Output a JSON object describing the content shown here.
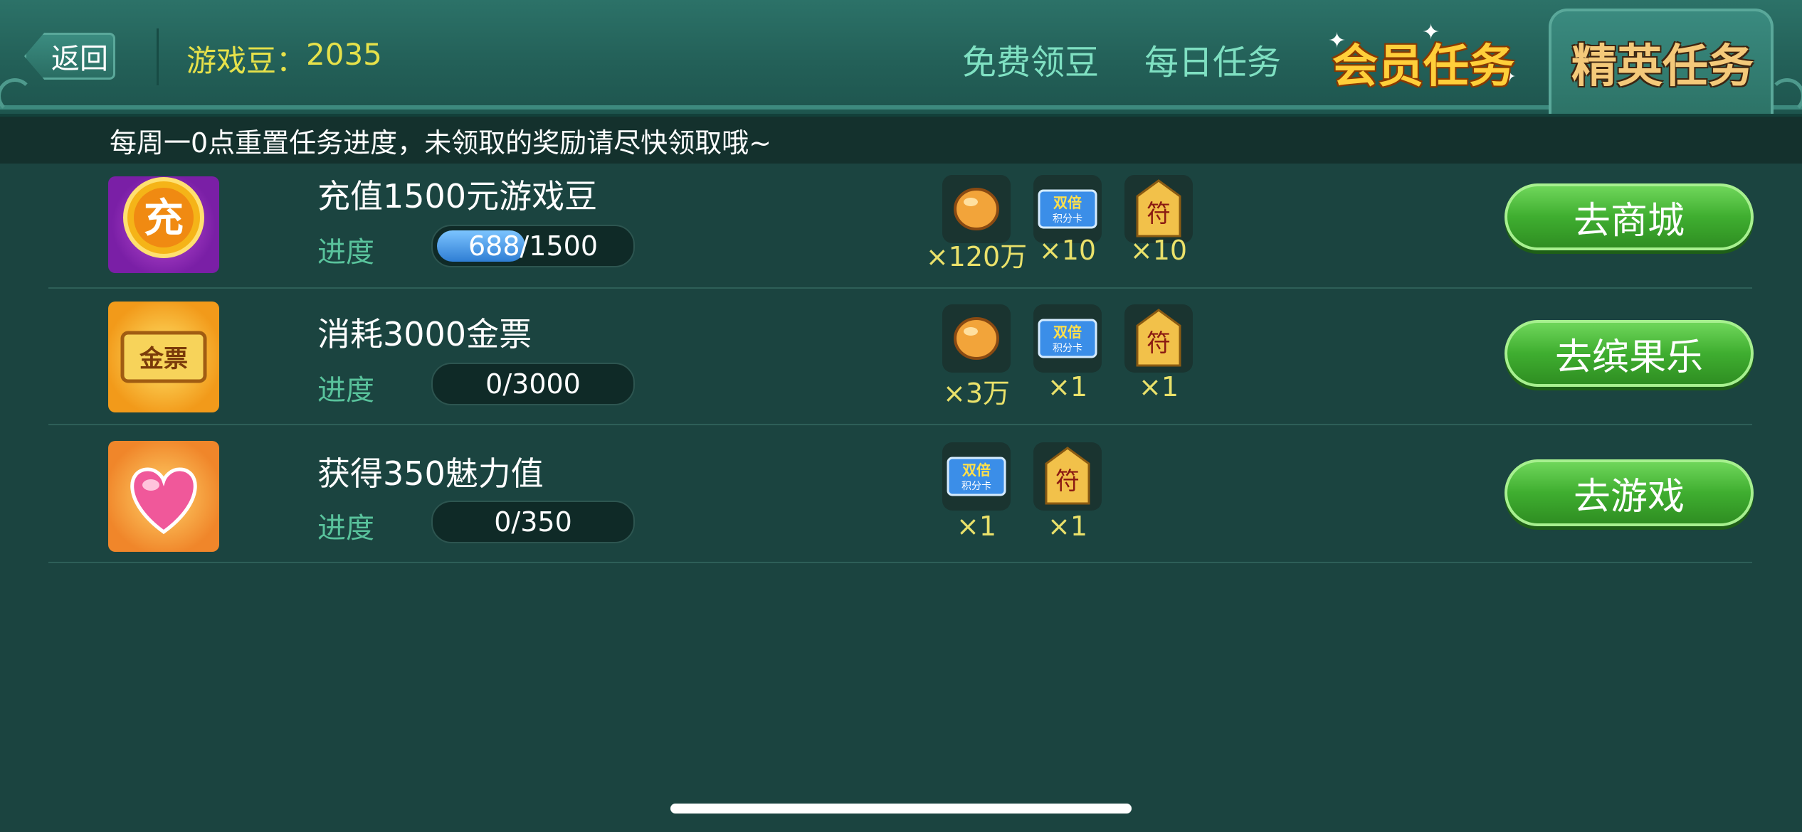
{
  "header": {
    "back_label": "返回",
    "beans_label": "游戏豆：",
    "beans_value": "2035",
    "tabs": [
      {
        "label": "免费领豆",
        "active": false
      },
      {
        "label": "每日任务",
        "active": false
      },
      {
        "label": "会员任务",
        "active": false
      },
      {
        "label": "精英任务",
        "active": true
      }
    ]
  },
  "notice": "每周一0点重置任务进度，未领取的奖励请尽快领取哦~",
  "tasks": [
    {
      "icon": "recharge-coin-icon",
      "icon_text": "充",
      "title": "充值1500元游戏豆",
      "progress_label": "进度",
      "progress_text": "688/1500",
      "progress_fraction": 0.4587,
      "rewards": [
        {
          "icon": "bean-icon",
          "qty": "×120万"
        },
        {
          "icon": "double-points-card-icon",
          "qty": "×10"
        },
        {
          "icon": "talisman-icon",
          "qty": "×10"
        }
      ],
      "button": "去商城"
    },
    {
      "icon": "gold-ticket-icon",
      "icon_text": "金票",
      "title": "消耗3000金票",
      "progress_label": "进度",
      "progress_text": "0/3000",
      "progress_fraction": 0,
      "rewards": [
        {
          "icon": "bean-icon",
          "qty": "×3万"
        },
        {
          "icon": "double-points-card-icon",
          "qty": "×1"
        },
        {
          "icon": "talisman-icon",
          "qty": "×1"
        }
      ],
      "button": "去缤果乐"
    },
    {
      "icon": "heart-icon",
      "icon_text": "",
      "title": "获得350魅力值",
      "progress_label": "进度",
      "progress_text": "0/350",
      "progress_fraction": 0,
      "rewards": [
        {
          "icon": "double-points-card-icon",
          "qty": "×1"
        },
        {
          "icon": "talisman-icon",
          "qty": "×1"
        }
      ],
      "button": "去游戏"
    }
  ],
  "reward_card_text": {
    "line1": "双倍",
    "line2": "积分卡"
  },
  "talisman_text": "符",
  "colors": {
    "background": "#1b4440",
    "accent_green": "#59c39c",
    "bean_yellow": "#e6e14a",
    "button_green": "#3fae30"
  }
}
